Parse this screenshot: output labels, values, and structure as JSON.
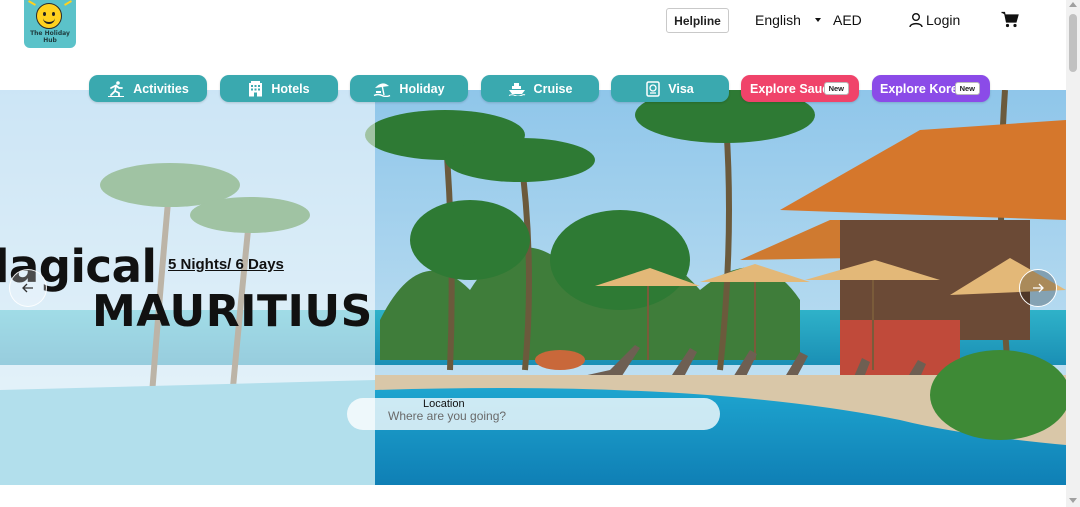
{
  "logo": {
    "text": "The Holiday Hub",
    "colors": {
      "background": "#5bc2c9",
      "face": "#ffd21f"
    }
  },
  "header": {
    "helpline_label": "Helpline",
    "language": "English",
    "currency": "AED",
    "login_label": "Login",
    "icons": {
      "login": "user-icon",
      "cart": "cart-icon",
      "language": "caret-down-icon"
    }
  },
  "nav": {
    "items": [
      {
        "label": "Activities",
        "icon": "running-person-icon"
      },
      {
        "label": "Hotels",
        "icon": "building-icon"
      },
      {
        "label": "Holiday",
        "icon": "beach-umbrella-icon"
      },
      {
        "label": "Cruise",
        "icon": "ship-icon"
      },
      {
        "label": "Visa",
        "icon": "passport-icon"
      },
      {
        "label": "Explore Saudi",
        "badge": "New",
        "color": "#f0436a"
      },
      {
        "label": "Explore Korea",
        "badge": "New",
        "color": "#8b4be8"
      }
    ],
    "color": "#3aa9af"
  },
  "hero": {
    "title_line1": "lagical",
    "title_line2": "MAURITIUS",
    "subtitle": "5 Nights/ 6 Days",
    "prev_icon": "arrow-left-icon",
    "next_icon": "arrow-right-icon"
  },
  "search": {
    "label": "Location",
    "placeholder": "Where are you going?"
  }
}
